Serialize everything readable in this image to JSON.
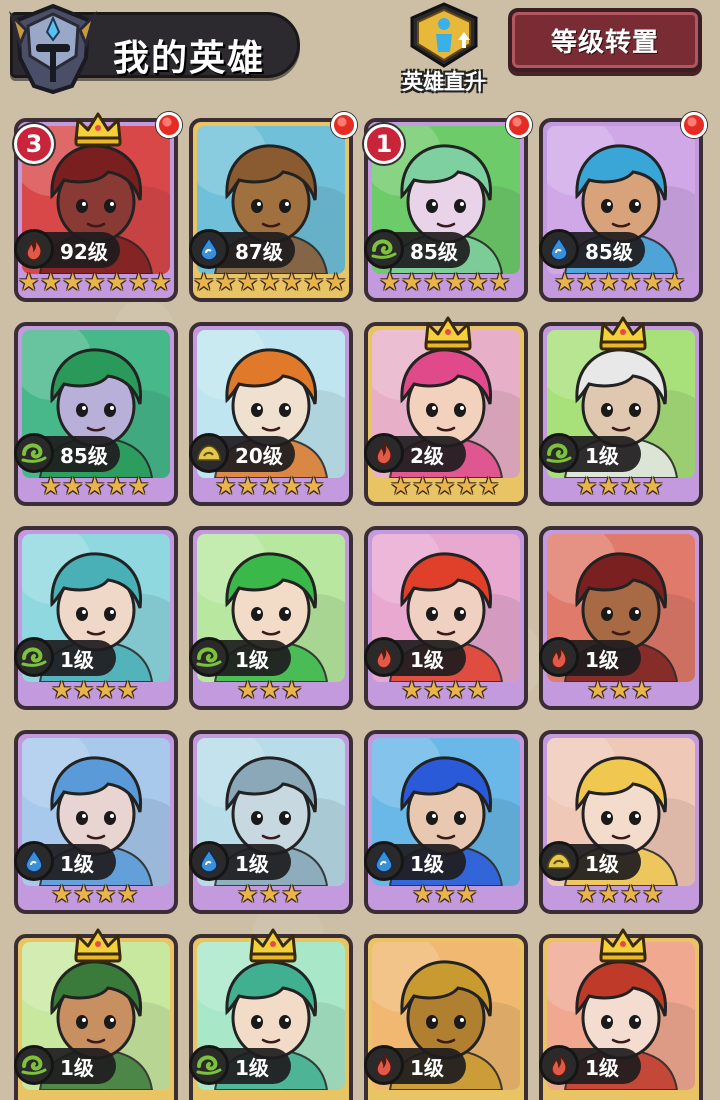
{
  "header": {
    "title": "我的英雄",
    "promote_label": "英雄直升",
    "transfer_label": "等级转置"
  },
  "colors": {
    "purple_frame": "#c49adf",
    "gold_frame": "#e8c464",
    "green_frame": "#89c25a",
    "red_dot": "#e22c24",
    "star": "#e9b44a",
    "fire": "#e05a4a",
    "water": "#3a8fd6",
    "wind": "#7cc23a",
    "earth": "#e4c84a"
  },
  "heroes": [
    {
      "level": "92级",
      "stars": 7,
      "element": "fire",
      "frame": "purple",
      "bg": "#d84848",
      "rank": "3",
      "crown": true,
      "dot": true,
      "hair": "#7a1f1f",
      "skin": "#8a3a34",
      "name": "minotaur-portrait"
    },
    {
      "level": "87级",
      "stars": 7,
      "element": "water",
      "frame": "gold",
      "bg": "#6fc0d8",
      "rank": "",
      "crown": false,
      "dot": true,
      "hair": "#8a5a30",
      "skin": "#a0703f",
      "name": "wooden-golem-portrait"
    },
    {
      "level": "85级",
      "stars": 6,
      "element": "wind",
      "frame": "purple",
      "bg": "#6ecb6a",
      "rank": "1",
      "crown": false,
      "dot": true,
      "hair": "#7fd0a0",
      "skin": "#e8d3e8",
      "name": "forest-sorceress-portrait"
    },
    {
      "level": "85级",
      "stars": 6,
      "element": "water",
      "frame": "purple",
      "bg": "#d0a8e8",
      "rank": "",
      "crown": false,
      "dot": true,
      "hair": "#3aa6d8",
      "skin": "#d8a27a",
      "name": "water-knight-portrait"
    },
    {
      "level": "85级",
      "stars": 5,
      "element": "wind",
      "frame": "purple",
      "bg": "#46b88a",
      "rank": "",
      "crown": false,
      "dot": false,
      "hair": "#2a9a5a",
      "skin": "#b8b0d8",
      "name": "green-sage-portrait"
    },
    {
      "level": "20级",
      "stars": 5,
      "element": "earth",
      "frame": "purple",
      "bg": "#bfe6f0",
      "rank": "",
      "crown": false,
      "dot": false,
      "hair": "#e07a2a",
      "skin": "#f0e0d0",
      "name": "tiger-warrior-portrait"
    },
    {
      "level": "2级",
      "stars": 5,
      "element": "fire",
      "frame": "gold",
      "bg": "#e8b0c8",
      "rank": "",
      "crown": true,
      "dot": false,
      "hair": "#e04a8a",
      "skin": "#f2d2bc",
      "name": "pink-engineer-portrait"
    },
    {
      "level": "1级",
      "stars": 4,
      "element": "wind",
      "frame": "purple",
      "bg": "#a8e07a",
      "rank": "",
      "crown": true,
      "dot": false,
      "hair": "#e8e8e8",
      "skin": "#e0c8b0",
      "name": "elder-elf-portrait"
    },
    {
      "level": "1级",
      "stars": 4,
      "element": "wind",
      "frame": "purple",
      "bg": "#8fd8e0",
      "rank": "",
      "crown": false,
      "dot": false,
      "hair": "#4ab0b8",
      "skin": "#f0d8c8",
      "name": "jade-priestess-portrait"
    },
    {
      "level": "1级",
      "stars": 3,
      "element": "wind",
      "frame": "purple",
      "bg": "#b8e8a0",
      "rank": "",
      "crown": false,
      "dot": false,
      "hair": "#3ab84a",
      "skin": "#f2dcc8",
      "name": "leaf-elf-portrait"
    },
    {
      "level": "1级",
      "stars": 4,
      "element": "fire",
      "frame": "purple",
      "bg": "#e8a8d0",
      "rank": "",
      "crown": false,
      "dot": false,
      "hair": "#e0402a",
      "skin": "#f0d0c0",
      "name": "flame-dancer-portrait"
    },
    {
      "level": "1级",
      "stars": 3,
      "element": "fire",
      "frame": "purple",
      "bg": "#e07a6a",
      "rank": "",
      "crown": false,
      "dot": false,
      "hair": "#7a2020",
      "skin": "#a86a44",
      "name": "desert-warrior-portrait"
    },
    {
      "level": "1级",
      "stars": 4,
      "element": "water",
      "frame": "purple",
      "bg": "#a8c8ec",
      "rank": "",
      "crown": false,
      "dot": false,
      "hair": "#5a9ad8",
      "skin": "#e8d4d0",
      "name": "blue-elf-portrait"
    },
    {
      "level": "1级",
      "stars": 3,
      "element": "water",
      "frame": "purple",
      "bg": "#b8dce8",
      "rank": "",
      "crown": false,
      "dot": false,
      "hair": "#8aa8b8",
      "skin": "#c8d8e0",
      "name": "shark-warrior-portrait"
    },
    {
      "level": "1级",
      "stars": 3,
      "element": "water",
      "frame": "purple",
      "bg": "#6ab8e8",
      "rank": "",
      "crown": false,
      "dot": false,
      "hair": "#2a5ad8",
      "skin": "#e8c8b0",
      "name": "sea-prince-portrait"
    },
    {
      "level": "1级",
      "stars": 4,
      "element": "earth",
      "frame": "purple",
      "bg": "#f0c8b8",
      "rank": "",
      "crown": false,
      "dot": false,
      "hair": "#f0c850",
      "skin": "#f4dccc",
      "name": "golden-girl-portrait"
    },
    {
      "level": "1级",
      "stars": 0,
      "element": "wind",
      "frame": "gold",
      "bg": "#c8e8a0",
      "rank": "",
      "crown": true,
      "dot": false,
      "hair": "#3a7a3a",
      "skin": "#c89060",
      "name": "tribal-druid-portrait"
    },
    {
      "level": "1级",
      "stars": 0,
      "element": "wind",
      "frame": "gold",
      "bg": "#a8e8c8",
      "rank": "",
      "crown": true,
      "dot": false,
      "hair": "#40b090",
      "skin": "#f2dcc8",
      "name": "jade-queen-portrait"
    },
    {
      "level": "1级",
      "stars": 0,
      "element": "fire",
      "frame": "gold",
      "bg": "#f0b870",
      "rank": "",
      "crown": false,
      "dot": false,
      "hair": "#c89a30",
      "skin": "#b08030",
      "name": "spartan-helm-portrait"
    },
    {
      "level": "1级",
      "stars": 0,
      "element": "fire",
      "frame": "gold",
      "bg": "#f0a890",
      "rank": "",
      "crown": true,
      "dot": false,
      "hair": "#c03a2a",
      "skin": "#f4dcd0",
      "name": "red-curls-portrait"
    }
  ]
}
